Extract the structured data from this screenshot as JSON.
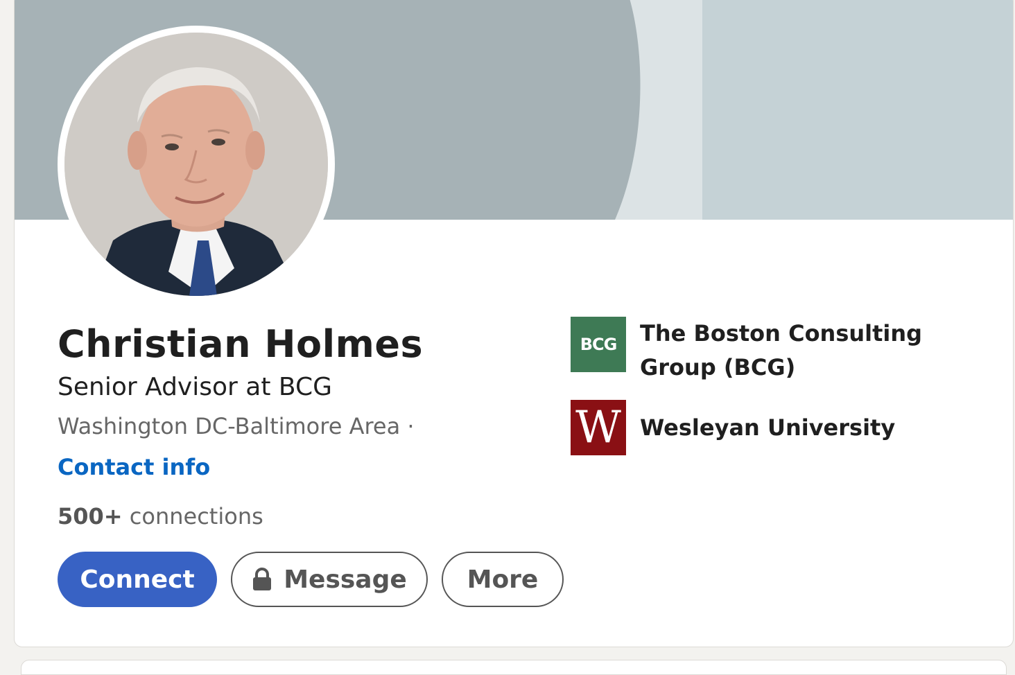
{
  "profile": {
    "name": "Christian Holmes",
    "headline": "Senior Advisor at BCG",
    "location": "Washington DC-Baltimore Area ·",
    "contact_info": "Contact info",
    "connections_count": "500+",
    "connections_label": " connections"
  },
  "actions": {
    "connect_label": "Connect",
    "message_label": "Message",
    "more_label": "More"
  },
  "organizations": [
    {
      "name": "The Boston Consulting Group (BCG)",
      "logo_text": "BCG",
      "logo_color": "#3e7a55"
    },
    {
      "name": "Wesleyan University",
      "logo_text": "W",
      "logo_color": "#8a1014"
    }
  ],
  "colors": {
    "primary": "#3862c4",
    "link": "#0a66c2",
    "banner_main": "#a6b2b6",
    "banner_light": "#dce3e5",
    "banner_right": "#c5d2d6"
  },
  "icons": {
    "message": "lock-icon"
  }
}
